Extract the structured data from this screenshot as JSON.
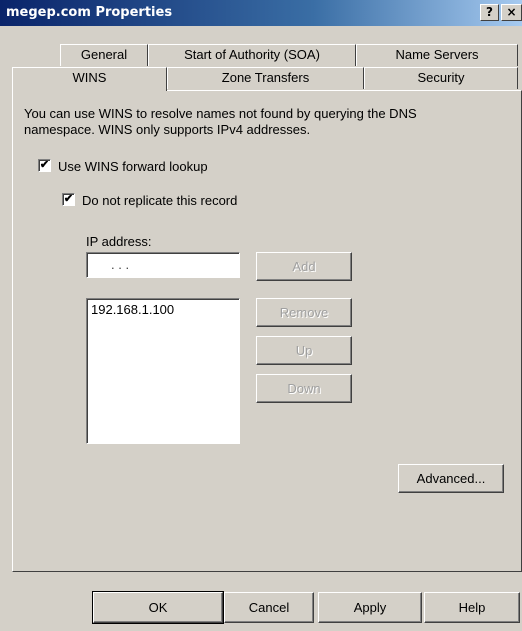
{
  "window": {
    "title": "megep.com Properties",
    "help_glyph": "?",
    "close_glyph": "×"
  },
  "tabs": {
    "row1": [
      "General",
      "Start of Authority (SOA)",
      "Name Servers"
    ],
    "row2": [
      "WINS",
      "Zone Transfers",
      "Security"
    ],
    "active": "WINS"
  },
  "wins": {
    "description_line1": "You can use WINS to resolve names not found by querying the DNS",
    "description_line2": "namespace.  WINS only supports IPv4 addresses.",
    "use_wins_label": "Use WINS forward lookup",
    "use_wins_checked": "✔",
    "no_replicate_label": "Do not replicate this record",
    "no_replicate_checked": "✔",
    "ip_label": "IP address:",
    "ip_input_value": ".        .        .",
    "add_label": "Add",
    "ip_list": [
      "192.168.1.100"
    ],
    "remove_label": "Remove",
    "up_label": "Up",
    "down_label": "Down",
    "advanced_label": "Advanced..."
  },
  "footer": {
    "ok": "OK",
    "cancel": "Cancel",
    "apply": "Apply",
    "help": "Help"
  }
}
